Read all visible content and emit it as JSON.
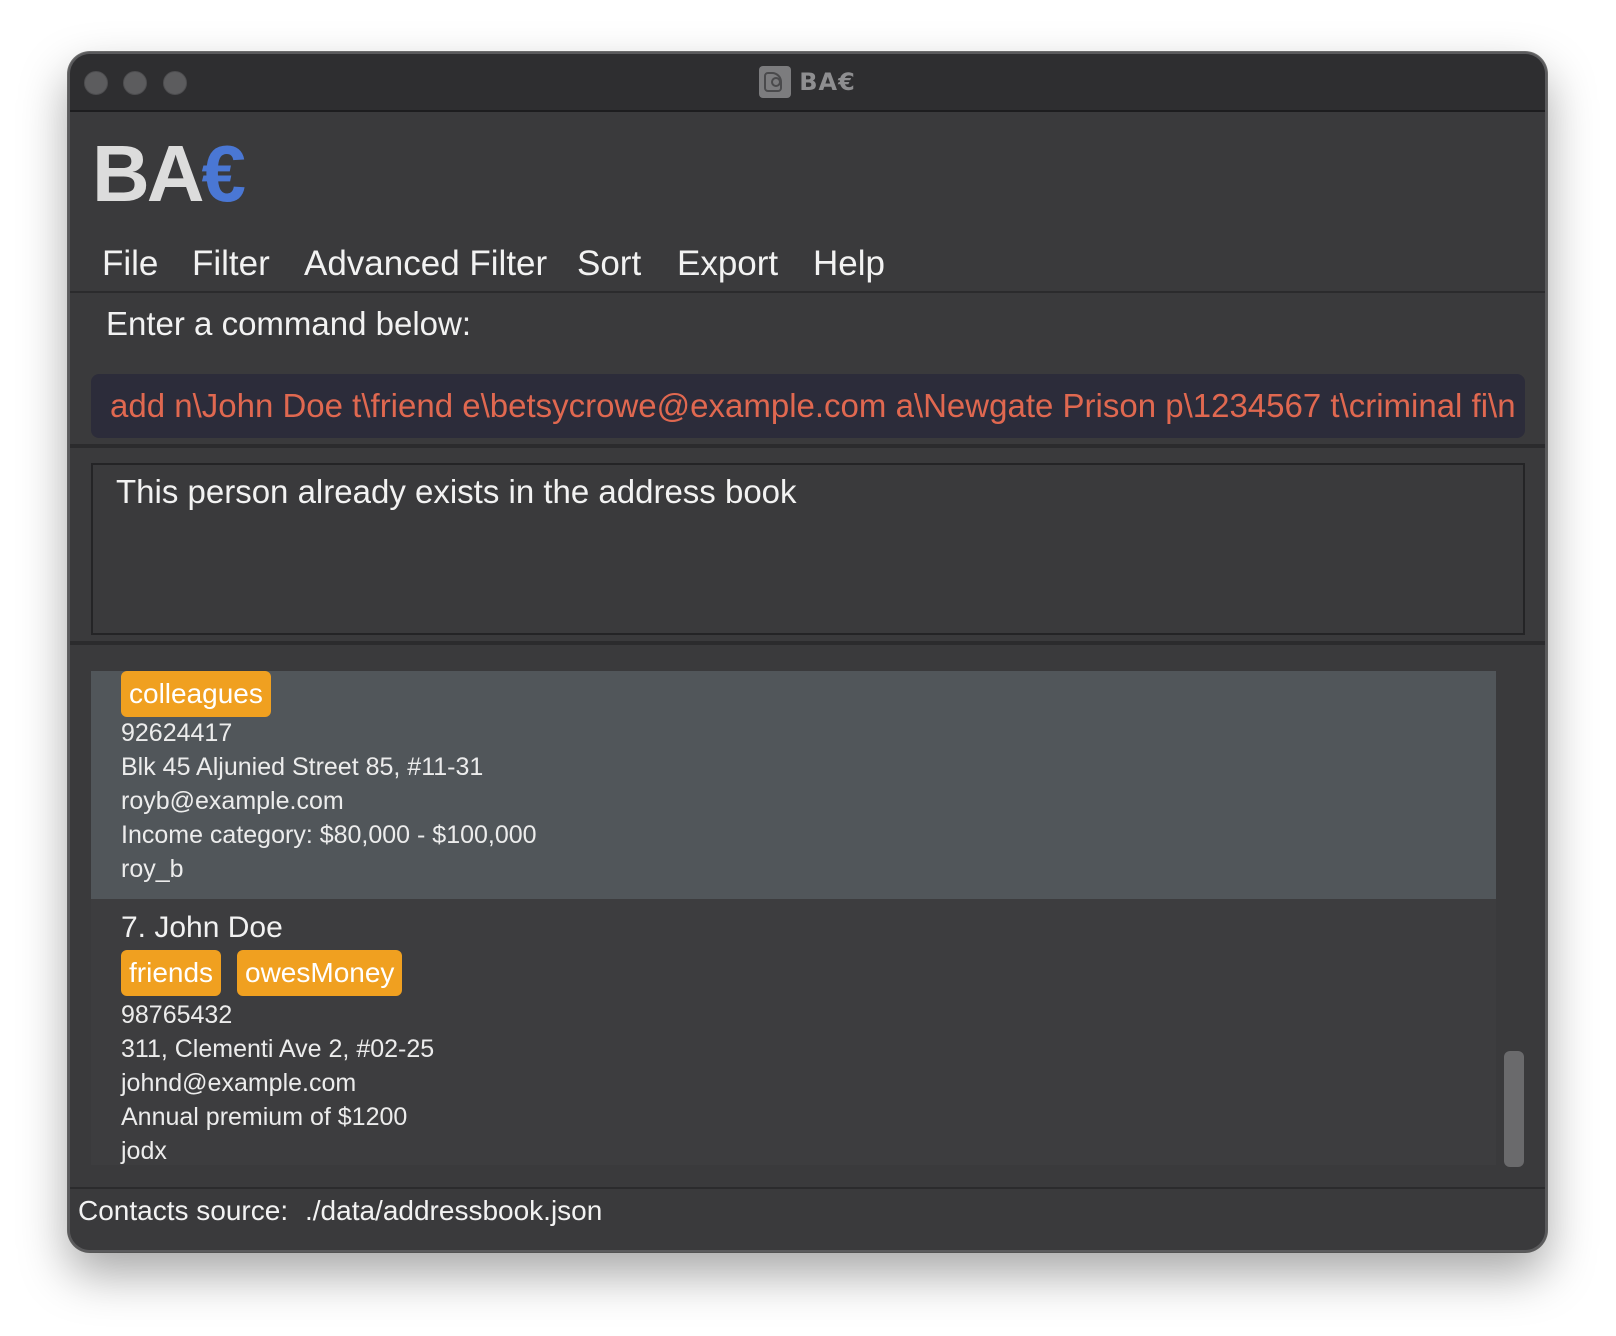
{
  "window": {
    "title": "BA€",
    "title_icon": "app-logo-icon"
  },
  "logo": {
    "main": "BA",
    "accent": "€",
    "accent_color": "#4a77d4"
  },
  "menu": {
    "items": [
      {
        "label": "File"
      },
      {
        "label": "Filter"
      },
      {
        "label": "Advanced Filter"
      },
      {
        "label": "Sort"
      },
      {
        "label": "Export"
      },
      {
        "label": "Help"
      }
    ]
  },
  "command": {
    "label": "Enter a command below:",
    "value": "add n\\John Doe t\\friend e\\betsycrowe@example.com a\\Newgate Prison p\\1234567 t\\criminal fi\\n",
    "text_color": "#e06850"
  },
  "result": {
    "message": "This person already exists in the address book"
  },
  "contacts": {
    "tag_color": "#f0a020",
    "cards": [
      {
        "selected": true,
        "tags": [
          "colleagues"
        ],
        "phone": "92624417",
        "address": "Blk 45 Aljunied Street 85, #11-31",
        "email": "royb@example.com",
        "extra": "Income category: $80,000 - $100,000",
        "handle": "roy_b"
      },
      {
        "selected": false,
        "name": "7. John Doe",
        "tags": [
          "friends",
          "owesMoney"
        ],
        "phone": "98765432",
        "address": "311, Clementi Ave 2, #02-25",
        "email": "johnd@example.com",
        "extra": "Annual premium of $1200",
        "handle": "jodx"
      }
    ]
  },
  "status": {
    "label": "Contacts source:",
    "value": "./data/addressbook.json"
  }
}
